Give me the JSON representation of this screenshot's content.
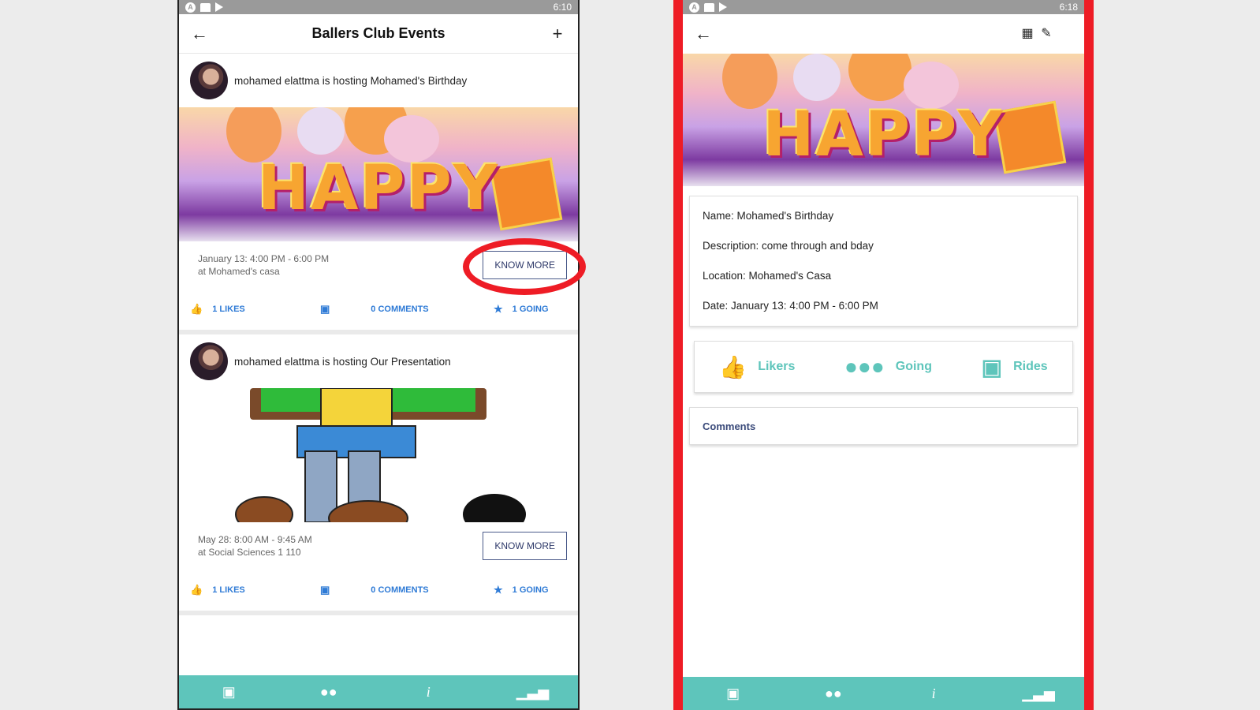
{
  "left": {
    "statusbar": {
      "time": "6:10"
    },
    "appbar": {
      "title": "Ballers Club Events",
      "back_icon": "arrow-left-icon",
      "add_icon": "plus-icon"
    },
    "events": [
      {
        "host_text": "mohamed elattma is hosting Mohamed's Birthday",
        "banner_text": "HAPPY",
        "date": "January 13: 4:00 PM - 6:00 PM",
        "location": "at Mohamed's casa",
        "know_more": "KNOW MORE",
        "likes": "1 LIKES",
        "comments": "0 COMMENTS",
        "going": "1 GOING"
      },
      {
        "host_text": "mohamed elattma is hosting Our Presentation",
        "date": "May 28: 8:00 AM - 9:45 AM",
        "location": "at Social Sciences 1 110",
        "know_more": "KNOW MORE",
        "likes": "1 LIKES",
        "comments": "0 COMMENTS",
        "going": "1 GOING"
      }
    ],
    "nav": {
      "calendar": "📅",
      "chat": "💬",
      "info": "i",
      "stats": "▐▐"
    }
  },
  "right": {
    "statusbar": {
      "time": "6:18"
    },
    "banner_text": "HAPPY",
    "details": {
      "name": "Name: Mohamed's Birthday",
      "description": "Description: come through and bday",
      "location": "Location: Mohamed's Casa",
      "date": "Date: January 13: 4:00 PM - 6:00 PM"
    },
    "stats": {
      "likers": "Likers",
      "going": "Going",
      "rides": "Rides"
    },
    "comments_label": "Comments"
  },
  "colors": {
    "accent": "#5ec5bb",
    "link_blue": "#2f7bd6",
    "highlight_red": "#ee1c25"
  }
}
